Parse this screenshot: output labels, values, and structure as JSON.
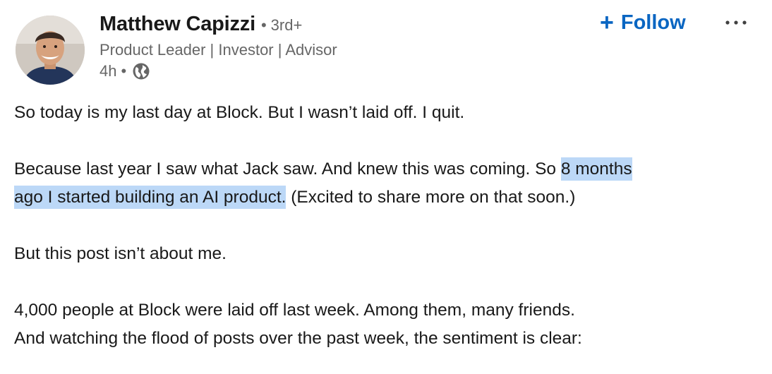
{
  "author": {
    "name": "Matthew Capizzi",
    "separator": "•",
    "degree": "3rd+",
    "headline": "Product Leader | Investor | Advisor",
    "time_ago": "4h",
    "visibility_icon": "globe-icon"
  },
  "actions": {
    "follow_label": "Follow",
    "follow_icon": "plus-icon",
    "follow_plus": "+",
    "more_icon": "ellipsis-icon"
  },
  "post": {
    "line1": "So today is my last day at Block. But I wasn’t laid off. I quit.",
    "line2_pre": "Because last year I saw what Jack saw.  And knew this was coming. So ",
    "line2_highlight_a": "8 months",
    "line3_highlight_b": "ago I started building an AI product.",
    "line3_post": " (Excited to share more on that soon.)",
    "line4": "But this post isn’t about me.",
    "line5": "4,000 people at Block were laid off last week. Among them, many friends.",
    "line6": "And watching the flood of posts over the past week, the sentiment is clear:"
  },
  "colors": {
    "link_blue": "#0a66c2",
    "highlight": "#bcd8f7",
    "text": "#191919",
    "muted": "#666666"
  }
}
